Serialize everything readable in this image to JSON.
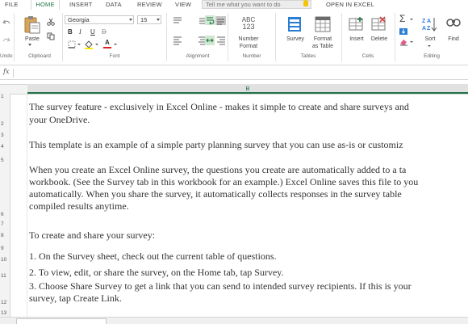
{
  "tabs": [
    "FILE",
    "HOME",
    "INSERT",
    "DATA",
    "REVIEW",
    "VIEW"
  ],
  "active_tab": "HOME",
  "tell_me": {
    "placeholder": "Tell me what you want to do"
  },
  "open_in_excel": "OPEN IN EXCEL",
  "ribbon": {
    "undo_label": "Undo",
    "clipboard": {
      "paste": "Paste",
      "group": "Clipboard"
    },
    "font": {
      "name": "Georgia",
      "size": "15",
      "bold": "B",
      "italic": "I",
      "underline": "U",
      "strike": "D",
      "color_glyph": "A",
      "group": "Font"
    },
    "alignment": {
      "group": "Alignment"
    },
    "number": {
      "abc": "ABC",
      "digits": "123",
      "format_line1": "Number",
      "format_line2": "Format",
      "group": "Number"
    },
    "tables": {
      "survey": "Survey",
      "format_table_line1": "Format",
      "format_table_line2": "as Table",
      "group": "Tables"
    },
    "cells": {
      "insert": "Insert",
      "delete": "Delete",
      "group": "Cells"
    },
    "editing": {
      "sum": "Σ",
      "sort": "Sort",
      "find": "Find",
      "group": "Editing"
    }
  },
  "formula_bar": {
    "fx": "fx"
  },
  "column_header": "B",
  "rows": [
    "1",
    "2",
    "3",
    "4",
    "5",
    "6",
    "7",
    "8",
    "9",
    "10",
    "11",
    "12",
    "13"
  ],
  "content": {
    "p1_line1": "The survey feature - exclusively in Excel Online - makes it simple to create and share surveys and",
    "p1_line2": "your OneDrive.",
    "p2": "This template is an example of a simple party planning survey that you can use as-is or customiz",
    "p3_line1": "When you create an Excel Online survey, the questions you create are automatically added to a ta",
    "p3_line2": "workbook. (See the Survey tab in this workbook for an example.) Excel Online saves this file to you",
    "p3_line3": "automatically. When you share the survey, it automatically collects responses in the survey table",
    "p3_line4": "compiled results anytime.",
    "p4": "To create and share your survey:",
    "step1": "1. On the Survey sheet, check out the current table of questions.",
    "step2": "2. To view, edit, or share the survey, on the Home tab, tap Survey.",
    "step3_line1": "3. Choose Share Survey to get a link that you can send to intended survey recipients. If this is your",
    "step3_line2": "survey, tap Create Link."
  },
  "colors": {
    "accent": "#217346",
    "bulb": "#f5c400",
    "survey_icon": "#2b7cd3"
  }
}
